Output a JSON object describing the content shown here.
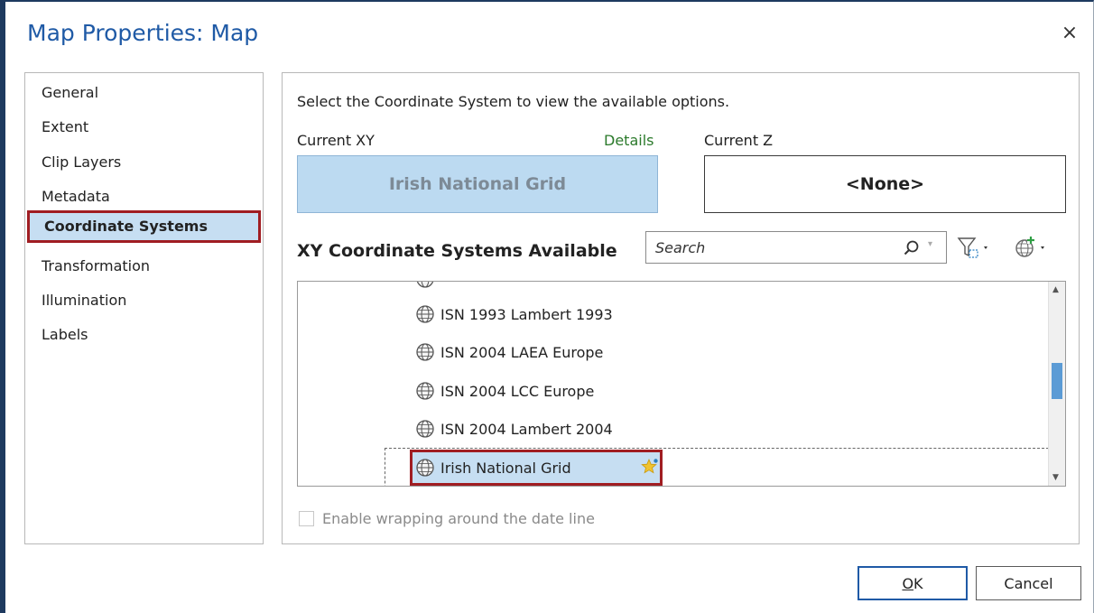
{
  "window": {
    "title": "Map Properties: Map",
    "close_glyph": "×"
  },
  "sidebar": {
    "items": [
      {
        "label": "General",
        "selected": false
      },
      {
        "label": "Extent",
        "selected": false
      },
      {
        "label": "Clip Layers",
        "selected": false
      },
      {
        "label": "Metadata",
        "selected": false
      },
      {
        "label": "Coordinate Systems",
        "selected": true
      },
      {
        "label": "Transformation",
        "selected": false
      },
      {
        "label": "Illumination",
        "selected": false
      },
      {
        "label": "Labels",
        "selected": false
      }
    ]
  },
  "main": {
    "instruction": "Select the Coordinate System to view the available options.",
    "current_xy_label": "Current XY",
    "details_link": "Details",
    "current_z_label": "Current Z",
    "current_xy_value": "Irish National Grid",
    "current_z_value": "<None>",
    "available_heading": "XY Coordinate Systems Available",
    "search": {
      "placeholder": "Search",
      "value": ""
    },
    "list_items": [
      {
        "label": "ISN 1993 Lambert 1993",
        "selected": false
      },
      {
        "label": "ISN 2004 LAEA Europe",
        "selected": false
      },
      {
        "label": "ISN 2004 LCC Europe",
        "selected": false
      },
      {
        "label": "ISN 2004 Lambert 2004",
        "selected": false
      },
      {
        "label": "Irish National Grid",
        "selected": true,
        "favorite": true
      }
    ],
    "wrap_checkbox": {
      "label": "Enable wrapping around the date line",
      "checked": false,
      "enabled": false
    }
  },
  "footer": {
    "ok_underlined": "O",
    "ok_rest": "K",
    "cancel_label": "Cancel"
  },
  "colors": {
    "title_blue": "#1f5aa6",
    "selection_fill": "#c6def2",
    "highlight_red": "#a01d22",
    "details_green": "#2b7a2b"
  },
  "icons": [
    "close-icon",
    "search-icon",
    "filter-icon",
    "add-coordinate-system-icon",
    "globe-icon",
    "favorite-star-icon"
  ]
}
